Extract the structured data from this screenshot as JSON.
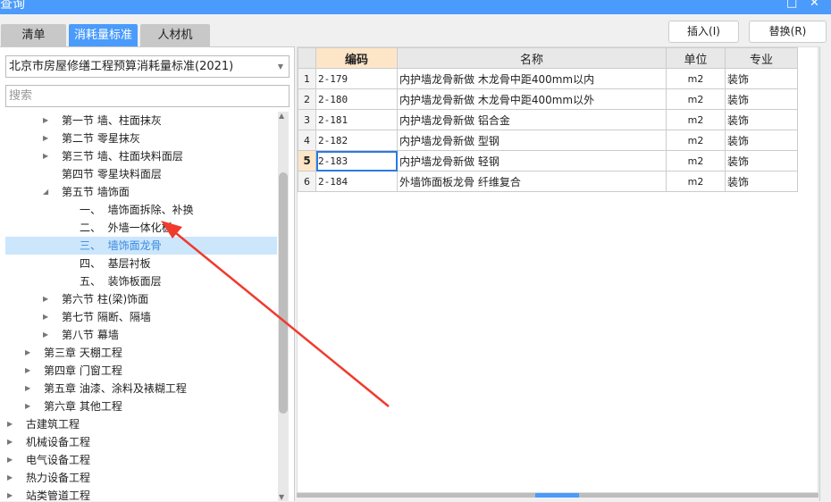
{
  "window": {
    "title": "查询",
    "maximize_icon": "□",
    "close_icon": "✕"
  },
  "tabs": [
    {
      "label": "清单"
    },
    {
      "label": "消耗量标准",
      "active": true
    },
    {
      "label": "人材机"
    }
  ],
  "toolbar": {
    "insert_label": "插入(I)",
    "replace_label": "替换(R)"
  },
  "left": {
    "standard_select": "北京市房屋修缮工程预算消耗量标准(2021)",
    "search_placeholder": "搜索",
    "tree": [
      {
        "label": "第一节 墙、柱面抹灰",
        "level": 2,
        "expander": "collapsed"
      },
      {
        "label": "第二节 零星抹灰",
        "level": 2,
        "expander": "collapsed"
      },
      {
        "label": "第三节 墙、柱面块料面层",
        "level": 2,
        "expander": "collapsed"
      },
      {
        "label": "第四节 零星块料面层",
        "level": 2,
        "expander": "none"
      },
      {
        "label": "第五节 墙饰面",
        "level": 2,
        "expander": "expanded"
      },
      {
        "label": "一、  墙饰面拆除、补换",
        "level": 3,
        "expander": "none"
      },
      {
        "label": "二、  外墙一体化板",
        "level": 3,
        "expander": "none"
      },
      {
        "label": "三、  墙饰面龙骨",
        "level": 3,
        "expander": "none",
        "selected": true
      },
      {
        "label": "四、  基层衬板",
        "level": 3,
        "expander": "none"
      },
      {
        "label": "五、  装饰板面层",
        "level": 3,
        "expander": "none"
      },
      {
        "label": "第六节 柱(梁)饰面",
        "level": 2,
        "expander": "collapsed"
      },
      {
        "label": "第七节 隔断、隔墙",
        "level": 2,
        "expander": "collapsed"
      },
      {
        "label": "第八节 幕墙",
        "level": 2,
        "expander": "collapsed"
      },
      {
        "label": "第三章 天棚工程",
        "level": 1,
        "expander": "collapsed"
      },
      {
        "label": "第四章 门窗工程",
        "level": 1,
        "expander": "collapsed"
      },
      {
        "label": "第五章 油漆、涂料及裱糊工程",
        "level": 1,
        "expander": "collapsed"
      },
      {
        "label": "第六章 其他工程",
        "level": 1,
        "expander": "collapsed"
      },
      {
        "label": "古建筑工程",
        "level": 0,
        "expander": "collapsed"
      },
      {
        "label": "机械设备工程",
        "level": 0,
        "expander": "collapsed"
      },
      {
        "label": "电气设备工程",
        "level": 0,
        "expander": "collapsed"
      },
      {
        "label": "热力设备工程",
        "level": 0,
        "expander": "collapsed"
      },
      {
        "label": "站类管道工程",
        "level": 0,
        "expander": "collapsed"
      }
    ]
  },
  "grid": {
    "columns": [
      "编码",
      "名称",
      "单位",
      "专业"
    ],
    "selected_row": 5,
    "rows": [
      {
        "no": "1",
        "code": "2-179",
        "name": "内护墙龙骨新做 木龙骨中距400mm以内",
        "unit": "m2",
        "spec": "装饰"
      },
      {
        "no": "2",
        "code": "2-180",
        "name": "内护墙龙骨新做 木龙骨中距400mm以外",
        "unit": "m2",
        "spec": "装饰"
      },
      {
        "no": "3",
        "code": "2-181",
        "name": "内护墙龙骨新做 铝合金",
        "unit": "m2",
        "spec": "装饰"
      },
      {
        "no": "4",
        "code": "2-182",
        "name": "内护墙龙骨新做 型钢",
        "unit": "m2",
        "spec": "装饰"
      },
      {
        "no": "5",
        "code": "2-183",
        "name": "内护墙龙骨新做 轻钢",
        "unit": "m2",
        "spec": "装饰"
      },
      {
        "no": "6",
        "code": "2-184",
        "name": "外墙饰面板龙骨 纤维复合",
        "unit": "m2",
        "spec": "装饰"
      }
    ]
  },
  "colors": {
    "accent": "#4a9bfb",
    "selection": "#cce6fc",
    "header_highlight": "#fde6c8",
    "annotation_arrow": "#f03a2e"
  }
}
